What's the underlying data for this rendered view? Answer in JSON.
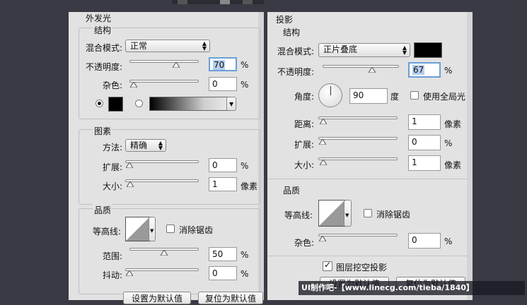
{
  "outer_glow": {
    "title": "外发光",
    "structure": {
      "title": "结构",
      "blend_mode_label": "混合模式:",
      "blend_mode_value": "正常",
      "opacity_label": "不透明度:",
      "opacity_value": "70",
      "opacity_unit": "%",
      "noise_label": "杂色:",
      "noise_value": "0",
      "noise_unit": "%",
      "opacity_slider": 0.7,
      "noise_slider": 0.0,
      "glow_color": "#000000"
    },
    "elements": {
      "title": "图素",
      "technique_label": "方法:",
      "technique_value": "精确",
      "spread_label": "扩展:",
      "spread_value": "0",
      "spread_unit": "%",
      "size_label": "大小:",
      "size_value": "1",
      "size_unit": "像素",
      "spread_slider": 0.0,
      "size_slider": 0.01
    },
    "quality": {
      "title": "品质",
      "contour_label": "等高线:",
      "anti_alias_label": "消除锯齿",
      "range_label": "范围:",
      "range_value": "50",
      "range_unit": "%",
      "jitter_label": "抖动:",
      "jitter_value": "0",
      "jitter_unit": "%",
      "range_slider": 0.5,
      "jitter_slider": 0.0
    },
    "buttons": {
      "make_default": "设置为默认值",
      "reset_default": "复位为默认值"
    }
  },
  "drop_shadow": {
    "title": "投影",
    "structure": {
      "title": "结构",
      "blend_mode_label": "混合模式:",
      "blend_mode_value": "正片叠底",
      "shadow_color": "#000000",
      "opacity_label": "不透明度:",
      "opacity_value": "67",
      "opacity_unit": "%",
      "opacity_slider": 0.67,
      "angle_label": "角度:",
      "angle_value": "90",
      "angle_unit": "度",
      "global_light_label": "使用全局光",
      "distance_label": "距离:",
      "distance_value": "1",
      "distance_unit": "像素",
      "spread_label": "扩展:",
      "spread_value": "0",
      "spread_unit": "%",
      "size_label": "大小:",
      "size_value": "1",
      "size_unit": "像素",
      "distance_slider": 0.01,
      "spread_slider": 0.0,
      "size_slider": 0.01
    },
    "quality": {
      "title": "品质",
      "contour_label": "等高线:",
      "anti_alias_label": "消除锯齿",
      "noise_label": "杂色:",
      "noise_value": "0",
      "noise_unit": "%",
      "noise_slider": 0.0
    },
    "knockout_label": "图层挖空投影",
    "knockout_checked": true,
    "buttons": {
      "make_default": "设置为默认值",
      "reset_default": "复位为默认值"
    }
  },
  "watermark": "UI制作吧-【www.linecg.com/tieba/1840】"
}
